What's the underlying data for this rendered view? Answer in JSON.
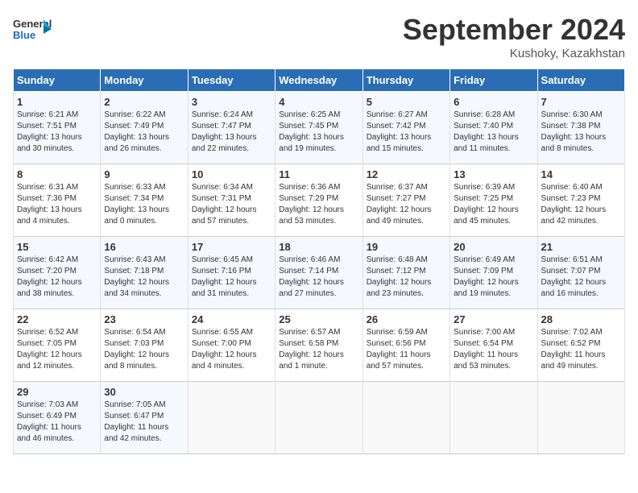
{
  "header": {
    "logo_line1": "General",
    "logo_line2": "Blue",
    "month_title": "September 2024",
    "location": "Kushoky, Kazakhstan"
  },
  "weekdays": [
    "Sunday",
    "Monday",
    "Tuesday",
    "Wednesday",
    "Thursday",
    "Friday",
    "Saturday"
  ],
  "weeks": [
    [
      {
        "day": "1",
        "info": "Sunrise: 6:21 AM\nSunset: 7:51 PM\nDaylight: 13 hours\nand 30 minutes."
      },
      {
        "day": "2",
        "info": "Sunrise: 6:22 AM\nSunset: 7:49 PM\nDaylight: 13 hours\nand 26 minutes."
      },
      {
        "day": "3",
        "info": "Sunrise: 6:24 AM\nSunset: 7:47 PM\nDaylight: 13 hours\nand 22 minutes."
      },
      {
        "day": "4",
        "info": "Sunrise: 6:25 AM\nSunset: 7:45 PM\nDaylight: 13 hours\nand 19 minutes."
      },
      {
        "day": "5",
        "info": "Sunrise: 6:27 AM\nSunset: 7:42 PM\nDaylight: 13 hours\nand 15 minutes."
      },
      {
        "day": "6",
        "info": "Sunrise: 6:28 AM\nSunset: 7:40 PM\nDaylight: 13 hours\nand 11 minutes."
      },
      {
        "day": "7",
        "info": "Sunrise: 6:30 AM\nSunset: 7:38 PM\nDaylight: 13 hours\nand 8 minutes."
      }
    ],
    [
      {
        "day": "8",
        "info": "Sunrise: 6:31 AM\nSunset: 7:36 PM\nDaylight: 13 hours\nand 4 minutes."
      },
      {
        "day": "9",
        "info": "Sunrise: 6:33 AM\nSunset: 7:34 PM\nDaylight: 13 hours\nand 0 minutes."
      },
      {
        "day": "10",
        "info": "Sunrise: 6:34 AM\nSunset: 7:31 PM\nDaylight: 12 hours\nand 57 minutes."
      },
      {
        "day": "11",
        "info": "Sunrise: 6:36 AM\nSunset: 7:29 PM\nDaylight: 12 hours\nand 53 minutes."
      },
      {
        "day": "12",
        "info": "Sunrise: 6:37 AM\nSunset: 7:27 PM\nDaylight: 12 hours\nand 49 minutes."
      },
      {
        "day": "13",
        "info": "Sunrise: 6:39 AM\nSunset: 7:25 PM\nDaylight: 12 hours\nand 45 minutes."
      },
      {
        "day": "14",
        "info": "Sunrise: 6:40 AM\nSunset: 7:23 PM\nDaylight: 12 hours\nand 42 minutes."
      }
    ],
    [
      {
        "day": "15",
        "info": "Sunrise: 6:42 AM\nSunset: 7:20 PM\nDaylight: 12 hours\nand 38 minutes."
      },
      {
        "day": "16",
        "info": "Sunrise: 6:43 AM\nSunset: 7:18 PM\nDaylight: 12 hours\nand 34 minutes."
      },
      {
        "day": "17",
        "info": "Sunrise: 6:45 AM\nSunset: 7:16 PM\nDaylight: 12 hours\nand 31 minutes."
      },
      {
        "day": "18",
        "info": "Sunrise: 6:46 AM\nSunset: 7:14 PM\nDaylight: 12 hours\nand 27 minutes."
      },
      {
        "day": "19",
        "info": "Sunrise: 6:48 AM\nSunset: 7:12 PM\nDaylight: 12 hours\nand 23 minutes."
      },
      {
        "day": "20",
        "info": "Sunrise: 6:49 AM\nSunset: 7:09 PM\nDaylight: 12 hours\nand 19 minutes."
      },
      {
        "day": "21",
        "info": "Sunrise: 6:51 AM\nSunset: 7:07 PM\nDaylight: 12 hours\nand 16 minutes."
      }
    ],
    [
      {
        "day": "22",
        "info": "Sunrise: 6:52 AM\nSunset: 7:05 PM\nDaylight: 12 hours\nand 12 minutes."
      },
      {
        "day": "23",
        "info": "Sunrise: 6:54 AM\nSunset: 7:03 PM\nDaylight: 12 hours\nand 8 minutes."
      },
      {
        "day": "24",
        "info": "Sunrise: 6:55 AM\nSunset: 7:00 PM\nDaylight: 12 hours\nand 4 minutes."
      },
      {
        "day": "25",
        "info": "Sunrise: 6:57 AM\nSunset: 6:58 PM\nDaylight: 12 hours\nand 1 minute."
      },
      {
        "day": "26",
        "info": "Sunrise: 6:59 AM\nSunset: 6:56 PM\nDaylight: 11 hours\nand 57 minutes."
      },
      {
        "day": "27",
        "info": "Sunrise: 7:00 AM\nSunset: 6:54 PM\nDaylight: 11 hours\nand 53 minutes."
      },
      {
        "day": "28",
        "info": "Sunrise: 7:02 AM\nSunset: 6:52 PM\nDaylight: 11 hours\nand 49 minutes."
      }
    ],
    [
      {
        "day": "29",
        "info": "Sunrise: 7:03 AM\nSunset: 6:49 PM\nDaylight: 11 hours\nand 46 minutes."
      },
      {
        "day": "30",
        "info": "Sunrise: 7:05 AM\nSunset: 6:47 PM\nDaylight: 11 hours\nand 42 minutes."
      },
      {
        "day": "",
        "info": ""
      },
      {
        "day": "",
        "info": ""
      },
      {
        "day": "",
        "info": ""
      },
      {
        "day": "",
        "info": ""
      },
      {
        "day": "",
        "info": ""
      }
    ]
  ]
}
